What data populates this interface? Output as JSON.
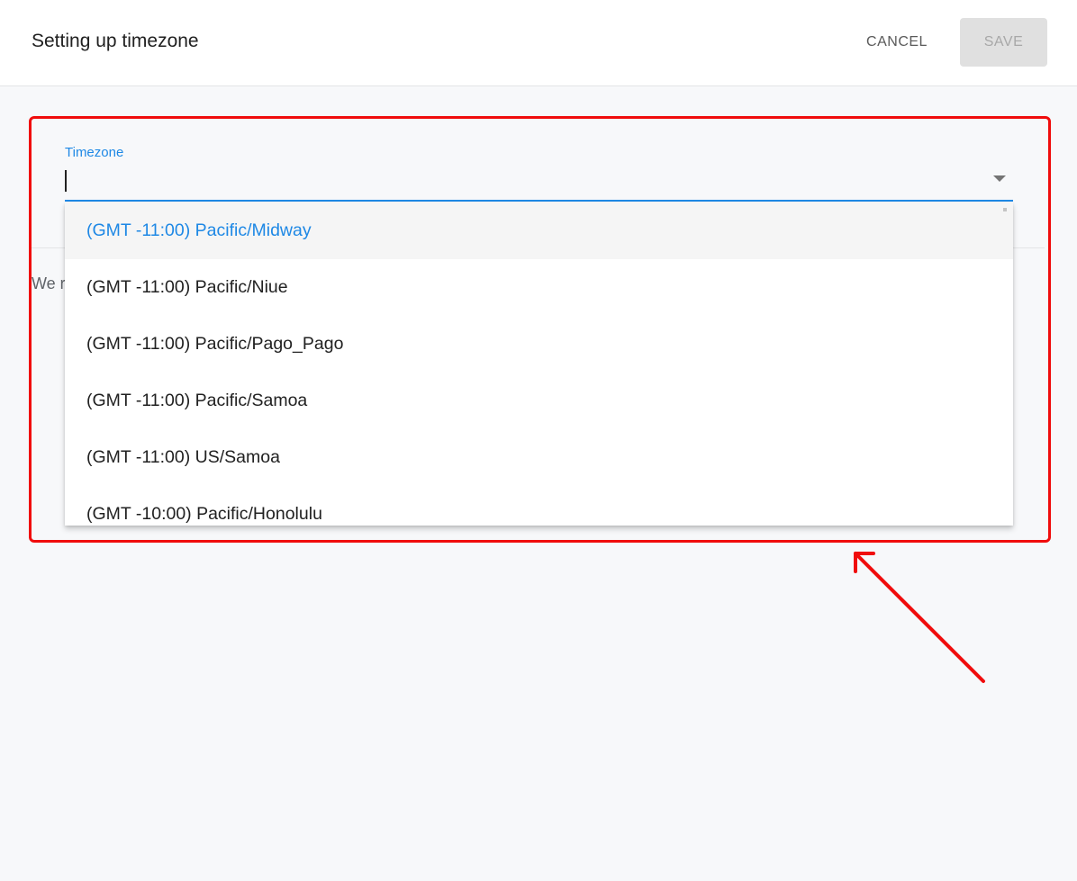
{
  "header": {
    "title": "Setting up timezone",
    "cancel_label": "CANCEL",
    "save_label": "SAVE"
  },
  "form": {
    "timezone_label": "Timezone",
    "timezone_value": "",
    "partial_text": "We r"
  },
  "dropdown": {
    "options": [
      "(GMT -11:00) Pacific/Midway",
      "(GMT -11:00) Pacific/Niue",
      "(GMT -11:00) Pacific/Pago_Pago",
      "(GMT -11:00) Pacific/Samoa",
      "(GMT -11:00) US/Samoa",
      "(GMT -10:00) Pacific/Honolulu"
    ],
    "highlighted_index": 0
  },
  "colors": {
    "accent": "#1e88e5",
    "annotation_red": "#f00c0c",
    "background": "#f7f8fa"
  }
}
